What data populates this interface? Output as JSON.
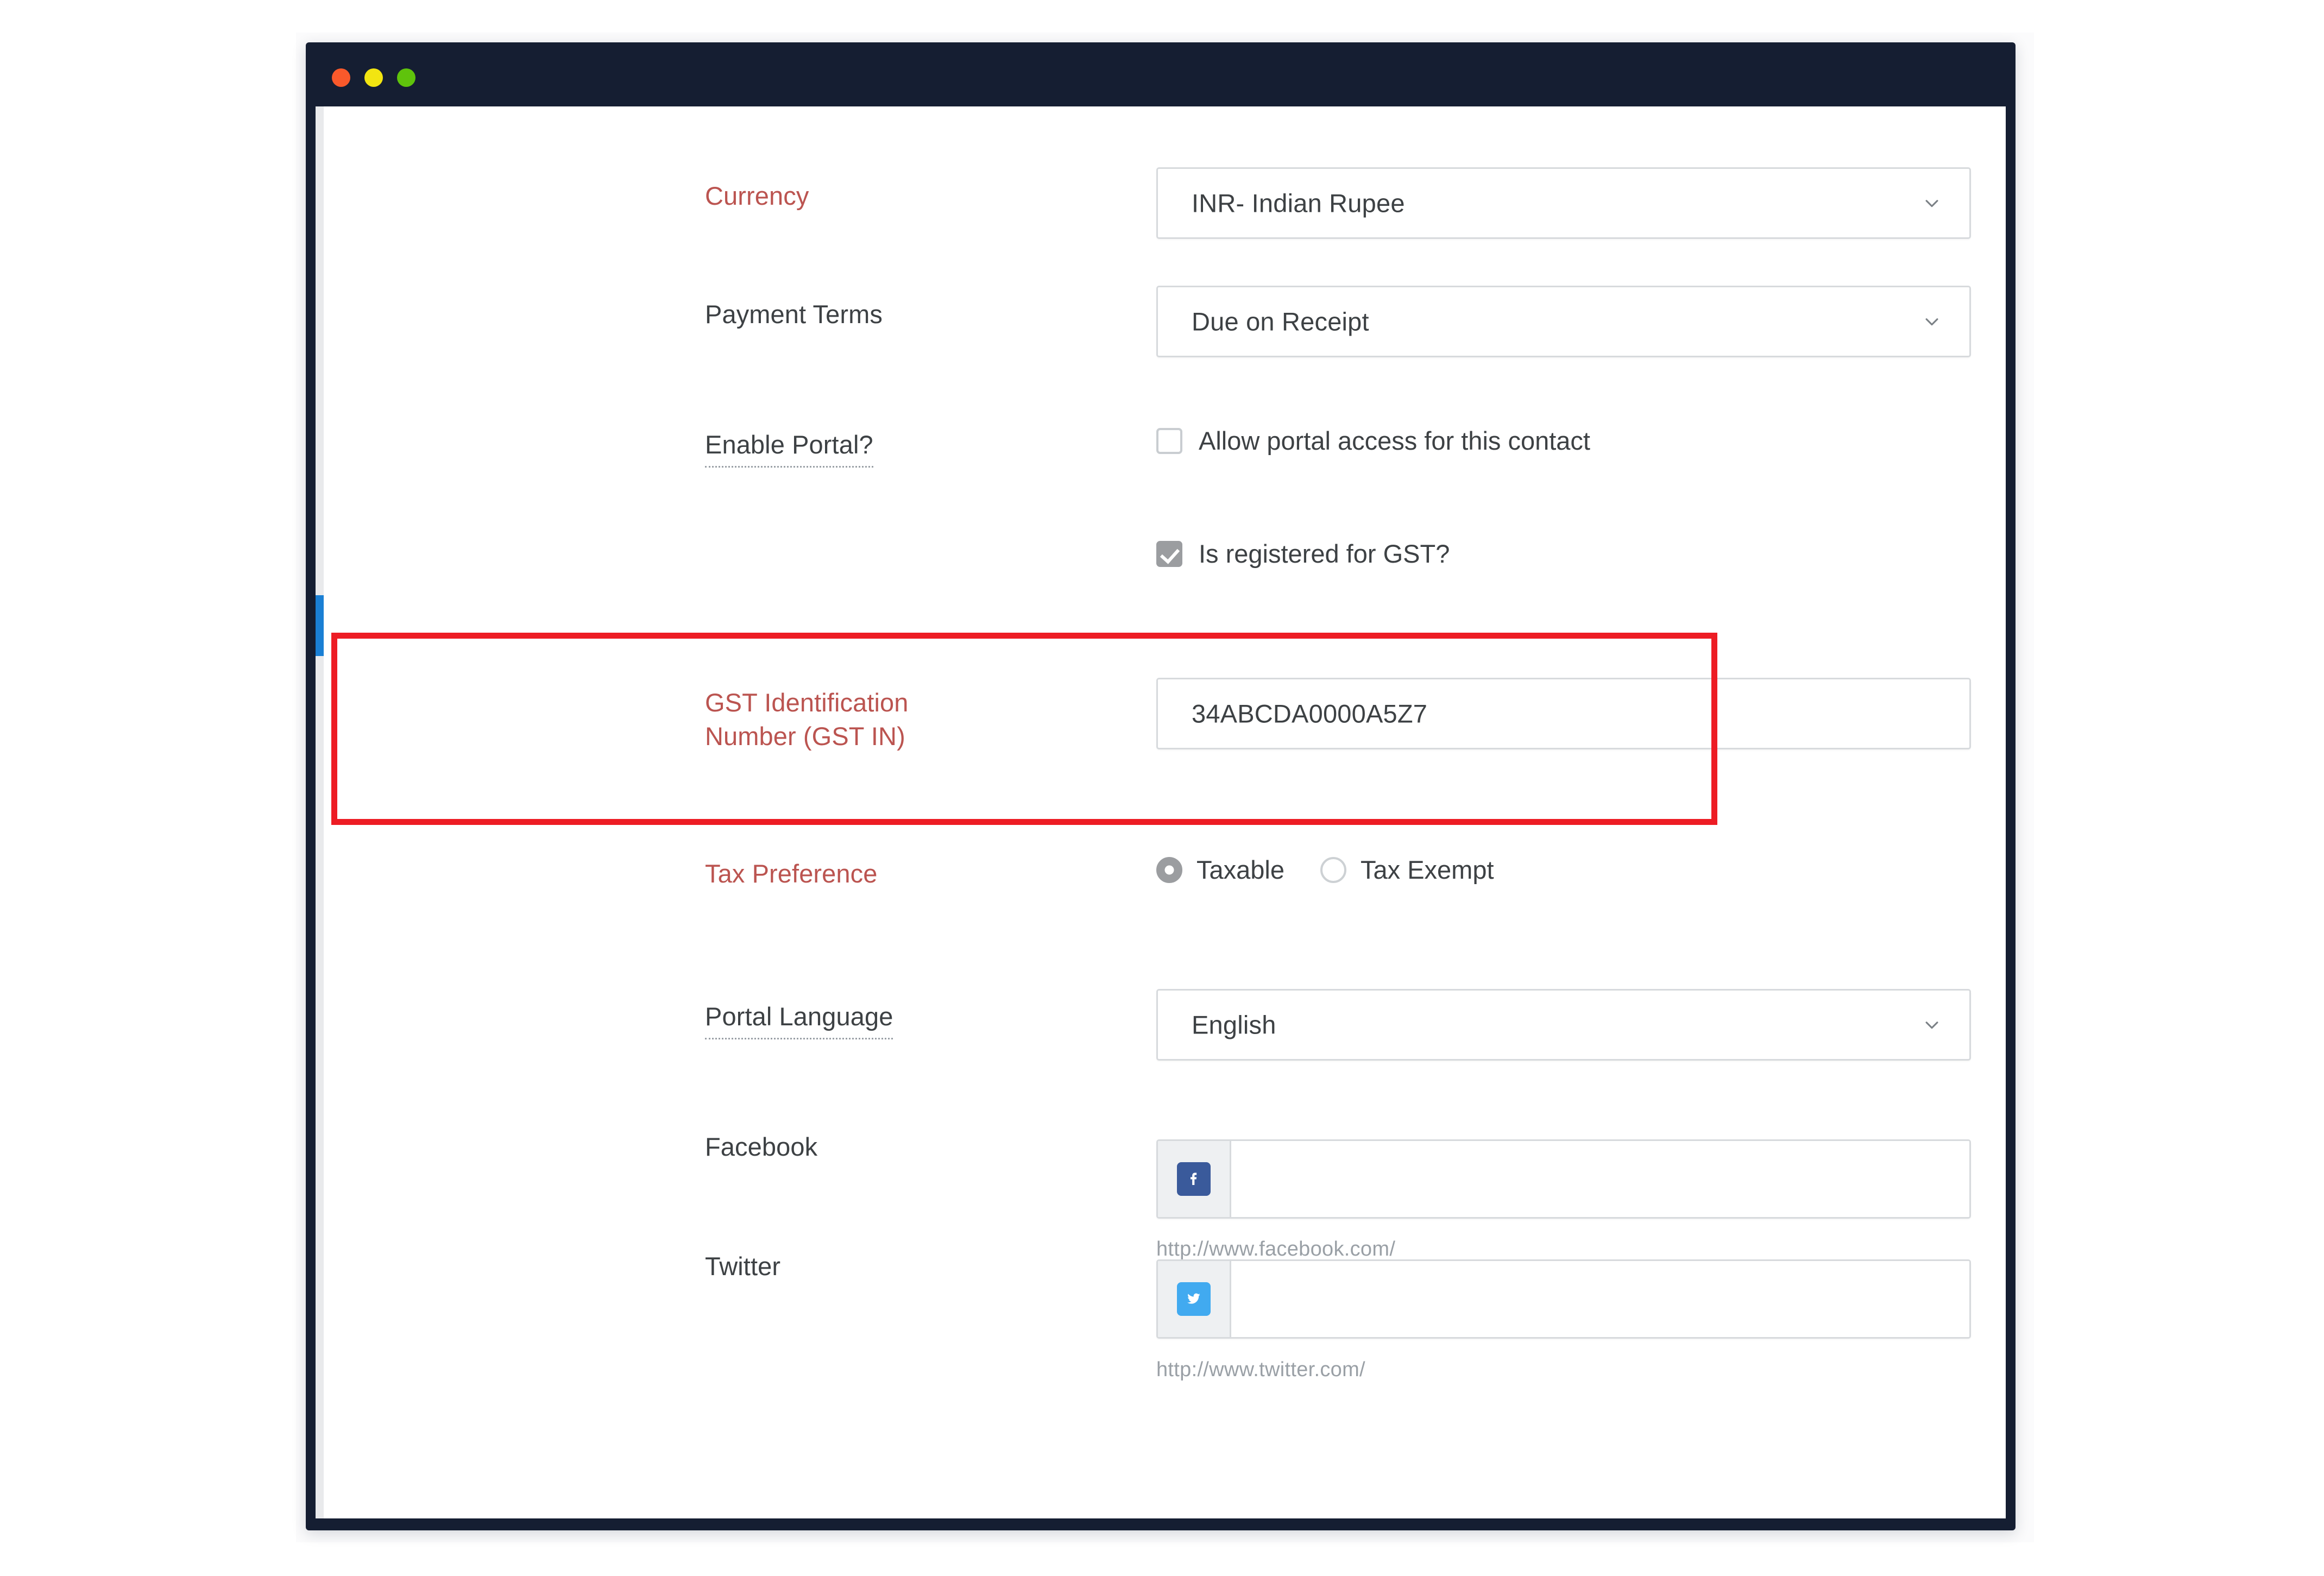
{
  "window": {
    "traffic_lights": [
      "close-red",
      "minimize-yellow",
      "maximize-green"
    ]
  },
  "colors": {
    "window_chrome": "#151e32",
    "required_label": "#bb5450",
    "label": "#3d4144",
    "scrollbar_thumb": "#1a7fd4",
    "highlight_border": "#ed1c24",
    "facebook_blue": "#3a5a9b",
    "twitter_blue": "#41aaf0",
    "checkbox_checked": "#9b9da0"
  },
  "form": {
    "currency": {
      "label": "Currency",
      "required": true,
      "value": "INR- Indian Rupee",
      "icon": "chevron-down-icon"
    },
    "payment_terms": {
      "label": "Payment Terms",
      "required": false,
      "value": "Due on Receipt",
      "icon": "chevron-down-icon"
    },
    "enable_portal": {
      "label": "Enable Portal?",
      "dotted_underline": true,
      "checkbox_label": "Allow portal access for this contact",
      "checked": false
    },
    "gst_registered": {
      "checkbox_label": "Is registered for GST?",
      "checked": true
    },
    "gst_number": {
      "label_line1": "GST Identification",
      "label_line2": "Number (GST IN)",
      "required": true,
      "value": "34ABCDA0000A5Z7",
      "highlighted": true
    },
    "tax_preference": {
      "label": "Tax Preference",
      "required": true,
      "options": [
        {
          "label": "Taxable",
          "selected": true
        },
        {
          "label": "Tax Exempt",
          "selected": false
        }
      ]
    },
    "portal_language": {
      "label": "Portal Language",
      "dotted_underline": true,
      "value": "English",
      "icon": "chevron-down-icon"
    },
    "facebook": {
      "label": "Facebook",
      "icon": "facebook-icon",
      "value": "",
      "hint": "http://www.facebook.com/"
    },
    "twitter": {
      "label": "Twitter",
      "icon": "twitter-icon",
      "value": "",
      "hint": "http://www.twitter.com/"
    }
  }
}
